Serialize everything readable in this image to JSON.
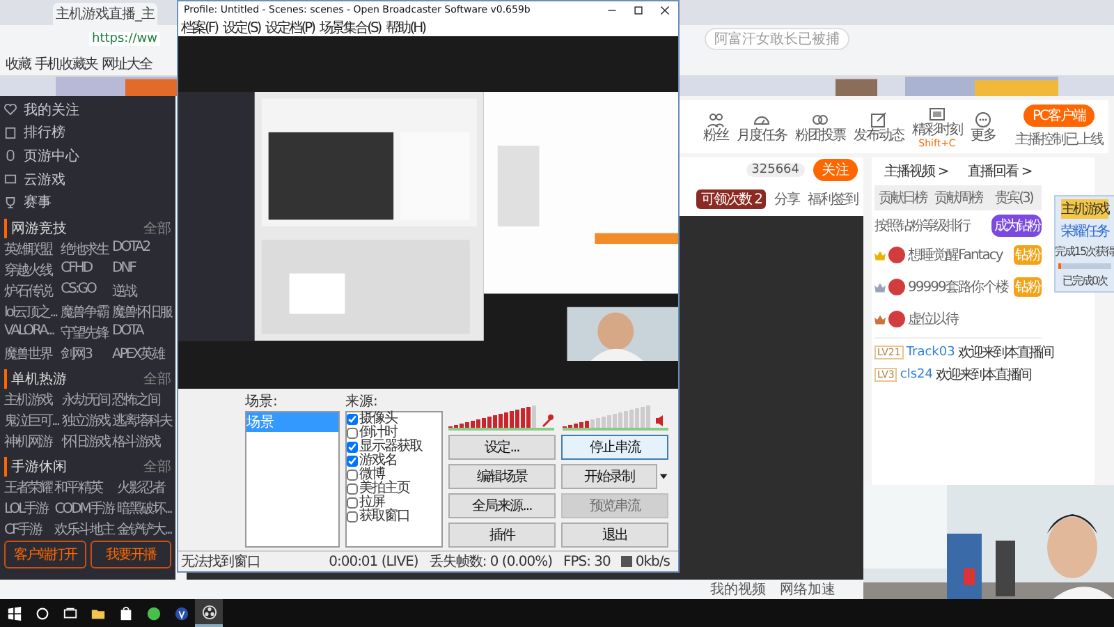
{
  "browser": {
    "tabs": [
      {
        "title": "主机游戏直播_主",
        "selected": true
      }
    ],
    "address": "https://ww",
    "search_placeholder": "阿富汗女敢长已被捕",
    "bookmarks": [
      "收藏",
      "手机收藏夹",
      "网址大全"
    ]
  },
  "site": {
    "sidebar": {
      "nav": [
        "我的关注",
        "排行榜",
        "页游中心",
        "云游戏",
        "赛事"
      ],
      "sections": [
        {
          "title": "网游竞技",
          "more": "全部",
          "games": [
            "英雄联盟",
            "绝地求生",
            "DOTA2",
            "穿越火线",
            "CFHD",
            "DNF",
            "炉石传说",
            "CS:GO",
            "逆战",
            "lol云顶之...",
            "魔兽争霸",
            "魔兽怀旧服",
            "VALORA...",
            "守望先锋",
            "DOTA",
            "魔兽世界",
            "剑网3",
            "APEX英雄"
          ]
        },
        {
          "title": "单机热游",
          "more": "全部",
          "games": [
            "主机游戏",
            "永劫无间",
            "恐怖之间",
            "鬼泣巨可...",
            "独立游戏",
            "逃离塔科夫",
            "神机网游",
            "怀旧游戏",
            "格斗游戏"
          ]
        },
        {
          "title": "手游休闲",
          "more": "全部",
          "games": [
            "王者荣耀",
            "和平精英",
            "火影忍者",
            "LOL手游",
            "CODM手游",
            "暗黑破坏...",
            "CF手游",
            "欢乐斗地主",
            "金铲铲大..."
          ]
        }
      ],
      "buttons": [
        "客户端打开",
        "我要开播"
      ]
    },
    "tools": [
      {
        "label": "粉丝"
      },
      {
        "label": "月度任务"
      },
      {
        "label": "粉团投票"
      },
      {
        "label": "发布动态"
      },
      {
        "label": "精彩时刻",
        "hint": "Shift+C"
      },
      {
        "label": "更多"
      }
    ],
    "client_button": "PC客户端",
    "client_note": "主播控制已上线",
    "follower_count": "325664",
    "follow_button": "关注",
    "claim_badge": "可领次数 2",
    "share": "分享",
    "sign": "福利签到",
    "panel": {
      "links": [
        "主播视频 >",
        "直播回看 >"
      ],
      "tabs": [
        {
          "label": "贡献日榜",
          "selected": false
        },
        {
          "label": "贡献周榜",
          "selected": false
        },
        {
          "label": "贵宾(3)",
          "selected": false
        }
      ],
      "note": "按照钻粉等级排行",
      "join": "成为钻粉",
      "fans": [
        {
          "name": "想睡觉醒Fantacy",
          "color": "#e8b400",
          "badge": "钻粉"
        },
        {
          "name": "99999套路你个楼",
          "color": "#9aa4b4",
          "badge": "钻粉"
        },
        {
          "name": "虚位以待",
          "color": "#c9743e"
        }
      ],
      "chat": [
        {
          "level": "LV21",
          "user": "Track03",
          "text": "欢迎来到本直播间"
        },
        {
          "level": "LV3",
          "user": "cls24",
          "text": "欢迎来到本直播间"
        }
      ]
    },
    "widget": {
      "tag": "主机游戏",
      "title": "荣耀任务",
      "note": "完成15次获得",
      "progress": "已完成0次",
      "level": 0.05
    },
    "status_links": [
      "我的视频",
      "网络加速"
    ]
  },
  "obs": {
    "title": "Profile: Untitled - Scenes: scenes - Open Broadcaster Software v0.659b",
    "menu": [
      "档案(F)",
      "设定(S)",
      "设定档(P)",
      "场景集合(S)",
      "帮助(H)"
    ],
    "scenes_label": "场景:",
    "scenes": [
      {
        "name": "场景",
        "selected": true
      }
    ],
    "sources_label": "来源:",
    "sources": [
      {
        "name": "摄像头",
        "checked": true
      },
      {
        "name": "倒计时",
        "checked": false
      },
      {
        "name": "显示器获取",
        "checked": true
      },
      {
        "name": "游戏名",
        "checked": true
      },
      {
        "name": "微博",
        "checked": false
      },
      {
        "name": "美拍主页",
        "checked": false
      },
      {
        "name": "拉屏",
        "checked": false
      },
      {
        "name": "获取窗口",
        "checked": false
      }
    ],
    "mic_meter": {
      "level": 0.95
    },
    "speaker_meter": {
      "level": 0.3
    },
    "buttons": [
      {
        "label": "设定...",
        "kind": "plain",
        "disabled": false
      },
      {
        "label": "停止串流",
        "kind": "primary",
        "disabled": false
      },
      {
        "label": "编辑场景",
        "kind": "plain",
        "disabled": false
      },
      {
        "label": "开始录制",
        "kind": "split",
        "disabled": false
      },
      {
        "label": "全局来源...",
        "kind": "plain",
        "disabled": false
      },
      {
        "label": "预览串流",
        "kind": "plain",
        "disabled": true
      },
      {
        "label": "插件",
        "kind": "plain",
        "disabled": false
      },
      {
        "label": "退出",
        "kind": "plain",
        "disabled": false
      }
    ],
    "status": {
      "message": "无法找到窗口",
      "time": "0:00:01 (LIVE)",
      "dropped": "丢失帧数: 0 (0.00%)",
      "fps": "FPS: 30",
      "rate": "0kb/s"
    }
  },
  "taskbar": [
    {
      "kind": "start",
      "active": false
    },
    {
      "kind": "search",
      "active": false
    },
    {
      "kind": "taskview",
      "active": false
    },
    {
      "kind": "folder",
      "active": false
    },
    {
      "kind": "store",
      "active": false
    },
    {
      "kind": "round-app",
      "active": false
    },
    {
      "kind": "v-app",
      "active": false
    },
    {
      "kind": "obs",
      "active": true
    }
  ]
}
